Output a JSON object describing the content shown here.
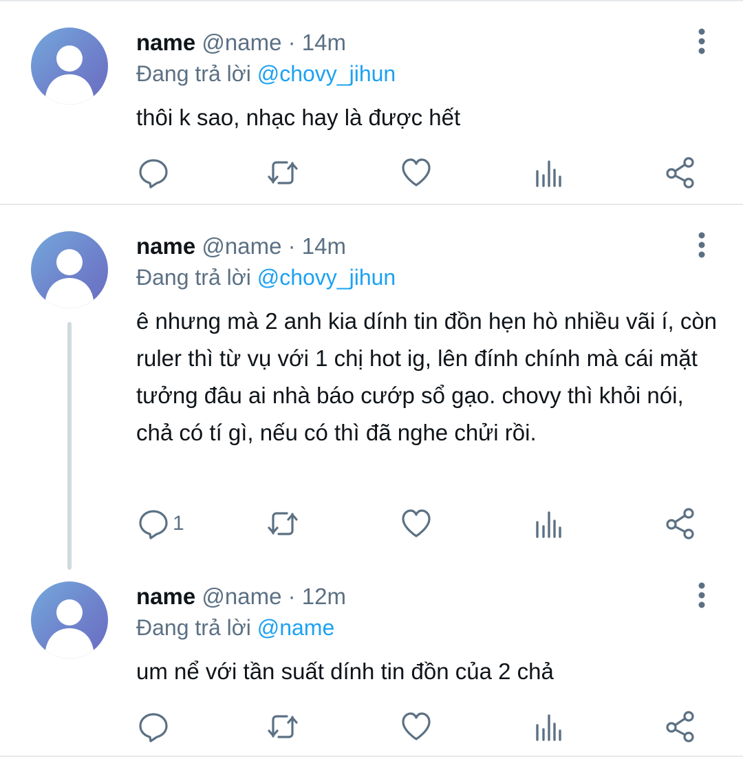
{
  "tweets": [
    {
      "name": "name",
      "handle": "@name",
      "dot": "·",
      "time": "14m",
      "reply_prefix": "Đang trả lời",
      "reply_to": "@chovy_jihun",
      "text": "thôi k sao, nhạc hay là được hết",
      "reply_count": ""
    },
    {
      "name": "name",
      "handle": "@name",
      "dot": "·",
      "time": "14m",
      "reply_prefix": "Đang trả lời",
      "reply_to": "@chovy_jihun",
      "text": "ê nhưng mà 2 anh kia dính tin đồn hẹn hò nhiều vãi í, còn ruler thì từ vụ với 1 chị hot ig, lên đính chính mà cái mặt tưởng đâu ai nhà báo cướp sổ gạo. chovy thì khỏi nói, chả có tí gì, nếu có thì đã nghe chửi rồi.",
      "reply_count": "1"
    },
    {
      "name": "name",
      "handle": "@name",
      "dot": "·",
      "time": "12m",
      "reply_prefix": "Đang trả lời",
      "reply_to": "@name",
      "text": "um nể với tần suất dính tin đồn của 2 chả",
      "reply_count": ""
    }
  ],
  "icons": {
    "reply": "reply-icon",
    "retweet": "retweet-icon",
    "like": "heart-icon",
    "analytics": "analytics-icon",
    "share": "share-icon",
    "more": "more-vertical-icon"
  },
  "colors": {
    "mention": "#1da1f2",
    "secondary_text": "#5b7083",
    "avatar_gradient": [
      "#74a9dc",
      "#6a6bc1"
    ]
  }
}
